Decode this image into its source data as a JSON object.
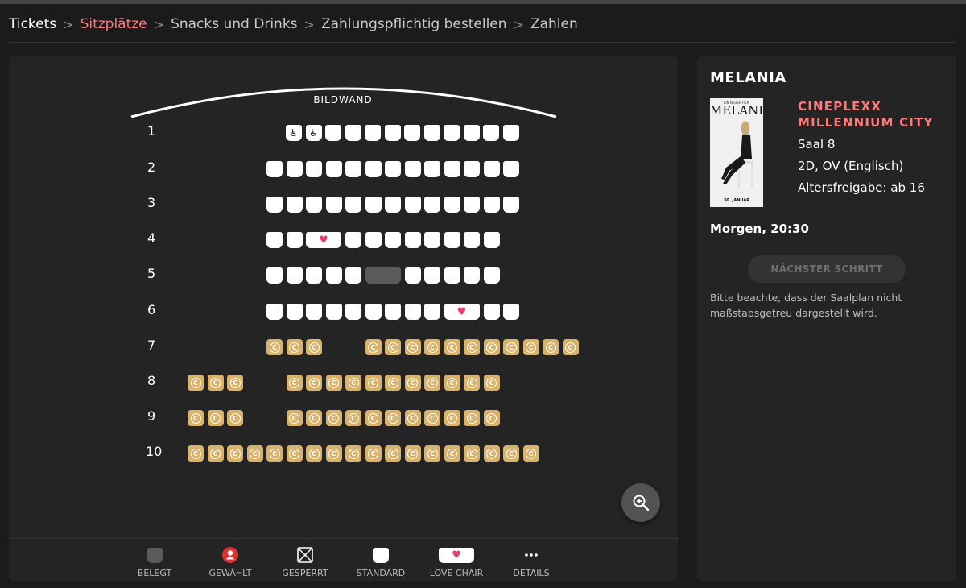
{
  "breadcrumb": {
    "items": [
      {
        "label": "Tickets",
        "state": "done"
      },
      {
        "label": "Sitzplätze",
        "state": "active"
      },
      {
        "label": "Snacks und Drinks",
        "state": "upcoming"
      },
      {
        "label": "Zahlungspflichtig bestellen",
        "state": "upcoming"
      },
      {
        "label": "Zahlen",
        "state": "upcoming"
      }
    ]
  },
  "seatmap": {
    "screen_label": "BILDWAND",
    "seat_mark_comfort": "C",
    "rows": [
      {
        "label": "1",
        "seats": [
          "wheelchair",
          "wheelchair",
          "standard",
          "standard",
          "standard",
          "standard",
          "standard",
          "standard",
          "standard",
          "standard",
          "standard",
          "standard"
        ]
      },
      {
        "label": "2",
        "seats": [
          "standard",
          "standard",
          "standard",
          "standard",
          "standard",
          "standard",
          "standard",
          "standard",
          "standard",
          "standard",
          "standard",
          "standard",
          "standard"
        ]
      },
      {
        "label": "3",
        "seats": [
          "standard",
          "standard",
          "standard",
          "standard",
          "standard",
          "standard",
          "standard",
          "standard",
          "standard",
          "standard",
          "standard",
          "standard",
          "standard"
        ]
      },
      {
        "label": "4",
        "seats": [
          "standard",
          "standard",
          "love",
          "standard",
          "standard",
          "standard",
          "standard",
          "standard",
          "standard",
          "standard",
          "standard"
        ]
      },
      {
        "label": "5",
        "seats": [
          "standard",
          "standard",
          "standard",
          "standard",
          "standard",
          "taken",
          "standard",
          "standard",
          "standard",
          "standard",
          "standard"
        ]
      },
      {
        "label": "6",
        "seats": [
          "standard",
          "standard",
          "standard",
          "standard",
          "standard",
          "standard",
          "standard",
          "standard",
          "standard",
          "love",
          "standard",
          "standard"
        ]
      },
      {
        "label": "7",
        "seats": [
          "comfort",
          "comfort",
          "comfort",
          "gap",
          "comfort",
          "comfort",
          "comfort",
          "comfort",
          "comfort",
          "comfort",
          "comfort",
          "comfort",
          "comfort",
          "comfort",
          "comfort"
        ]
      },
      {
        "label": "8",
        "seats": [
          "comfort",
          "comfort",
          "comfort",
          "gap",
          "comfort",
          "comfort",
          "comfort",
          "comfort",
          "comfort",
          "comfort",
          "comfort",
          "comfort",
          "comfort",
          "comfort",
          "comfort"
        ]
      },
      {
        "label": "9",
        "seats": [
          "comfort",
          "comfort",
          "comfort",
          "gap",
          "comfort",
          "comfort",
          "comfort",
          "comfort",
          "comfort",
          "comfort",
          "comfort",
          "comfort",
          "comfort",
          "comfort",
          "comfort"
        ]
      },
      {
        "label": "10",
        "seats": [
          "comfort",
          "comfort",
          "comfort",
          "comfort",
          "comfort",
          "comfort",
          "comfort",
          "comfort",
          "comfort",
          "comfort",
          "comfort",
          "comfort",
          "comfort",
          "comfort",
          "comfort",
          "comfort",
          "comfort",
          "comfort"
        ]
      }
    ],
    "zoom_icon": "zoom-in-icon"
  },
  "legend": [
    {
      "label": "BELEGT",
      "icon": "taken-seat-icon"
    },
    {
      "label": "GEWÄHLT",
      "icon": "selected-person-icon"
    },
    {
      "label": "GESPERRT",
      "icon": "blocked-seat-icon"
    },
    {
      "label": "STANDARD",
      "icon": "standard-seat-icon"
    },
    {
      "label": "LOVE CHAIR",
      "icon": "love-chair-icon"
    },
    {
      "label": "DETAILS",
      "icon": "more-dots-icon"
    }
  ],
  "info": {
    "film_title": "MELANIA",
    "poster": {
      "top_text": "EIN NEUER FILM",
      "title": "MELANIA",
      "date": "30. JANUAR"
    },
    "cinema_name": "CINEPLEXX MILLENNIUM CITY",
    "hall": "Saal 8",
    "format": "2D, OV (Englisch)",
    "age_rating": "Altersfreigabe: ab 16",
    "showtime": "Morgen, 20:30",
    "next_button": "NÄCHSTER SCHRITT",
    "note": "Bitte beachte, dass der Saalplan nicht maßstabsgetreu dargestellt wird."
  },
  "colors": {
    "background": "#1b1b1b",
    "panel": "#242424",
    "accent": "#ff7b7b",
    "standard_seat": "#ffffff",
    "comfort_seat": "#d9b36c",
    "taken_seat": "#5a5a5a",
    "love_heart": "#e83e77",
    "selected": "#e03131"
  }
}
